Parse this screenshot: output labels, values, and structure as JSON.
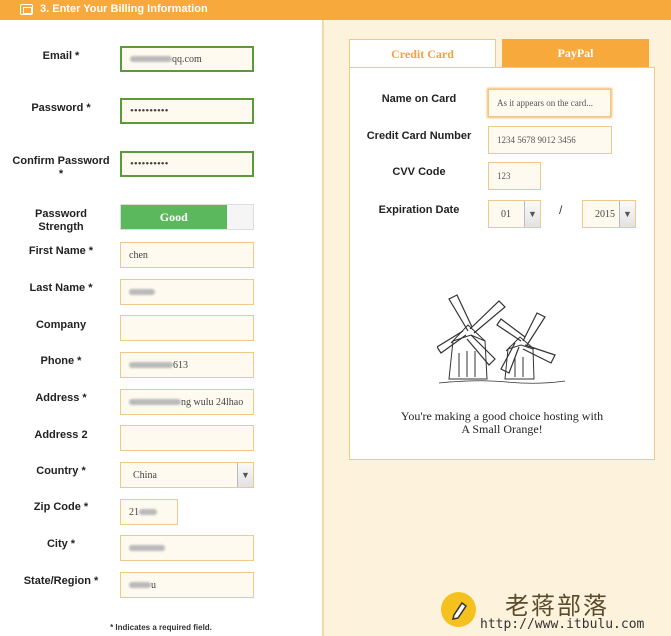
{
  "header": {
    "title": "3. Enter Your Billing Information",
    "icon": "card-icon"
  },
  "form": {
    "email": {
      "label": "Email *",
      "value_suffix": "qq.com"
    },
    "password": {
      "label": "Password *",
      "value": "••••••••••"
    },
    "confirm_password": {
      "label": "Confirm Password *",
      "value": "••••••••••"
    },
    "strength": {
      "label": "Password Strength",
      "value": "Good",
      "level": 0.8,
      "color": "#5cb85c"
    },
    "first_name": {
      "label": "First Name *",
      "value": "chen"
    },
    "last_name": {
      "label": "Last Name *"
    },
    "company": {
      "label": "Company",
      "value": ""
    },
    "phone": {
      "label": "Phone *",
      "value_suffix": "613"
    },
    "address": {
      "label": "Address *",
      "value_suffix": "ng wulu 24lhao"
    },
    "address2": {
      "label": "Address 2",
      "value": ""
    },
    "country": {
      "label": "Country *",
      "value": "China"
    },
    "zip": {
      "label": "Zip Code *",
      "value_prefix": "21"
    },
    "city": {
      "label": "City *"
    },
    "state": {
      "label": "State/Region *",
      "value_suffix": "u"
    },
    "required_note": "* Indicates a required field."
  },
  "payment": {
    "tabs": [
      {
        "label": "Credit Card",
        "active": true
      },
      {
        "label": "PayPal",
        "active": false
      }
    ],
    "name_on_card": {
      "label": "Name on Card",
      "placeholder": "As it appears on the card..."
    },
    "card_number": {
      "label": "Credit Card Number",
      "placeholder": "1234 5678 9012 3456"
    },
    "cvv": {
      "label": "CVV Code",
      "placeholder": "123"
    },
    "expiration": {
      "label": "Expiration Date",
      "month": "01",
      "separator": "/",
      "year": "2015"
    },
    "tagline_line1": "You're making a good choice hosting with",
    "tagline_line2": "A Small Orange!"
  },
  "watermark": {
    "name": "老蒋部落",
    "url": "http://www.itbulu.com"
  },
  "colors": {
    "accent": "#f7a93c",
    "valid_border": "#5a9a3a",
    "input_border": "#f0c98a"
  }
}
